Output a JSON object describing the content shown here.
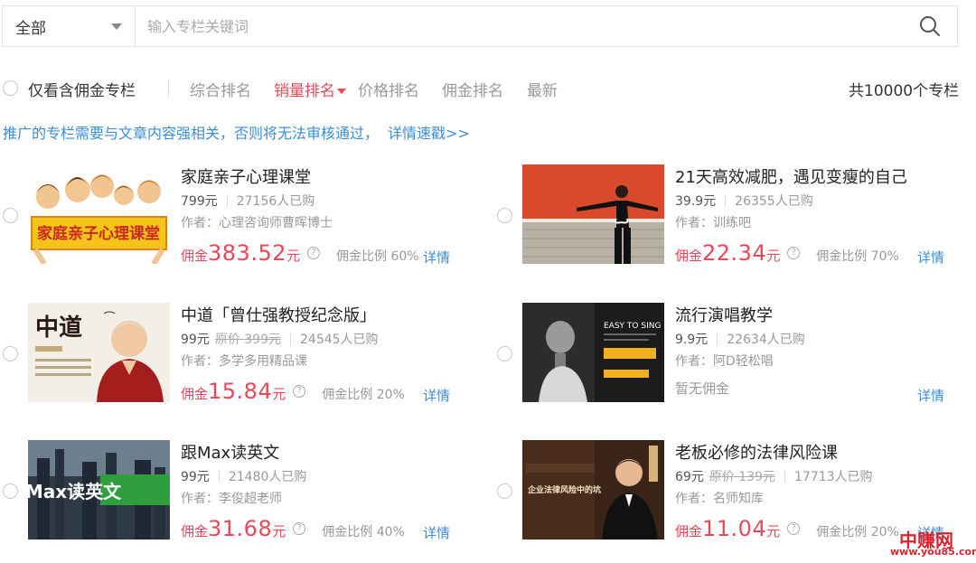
{
  "search": {
    "scope_label": "全部",
    "placeholder": "输入专栏关键词"
  },
  "filter": {
    "only_commission_label": "仅看含佣金专栏",
    "sort_options": [
      "综合排名",
      "销量排名",
      "价格排名",
      "佣金排名",
      "最新"
    ],
    "active_sort": "销量排名",
    "total_label": "共10000个专栏"
  },
  "notice": {
    "text": "推广的专栏需要与文章内容强相关，否则将无法审核通过，",
    "link": "详情速戳>>"
  },
  "cards": [
    {
      "title": "家庭亲子心理课堂",
      "price": "799元",
      "orig_price": "",
      "buyers": "27156人已购",
      "author": "作者：心理咨询师曹晖博士",
      "commission_label": "佣金",
      "commission_amount": "383.52",
      "commission_unit": "元",
      "ratio": "佣金比例 60%",
      "no_commission": "",
      "detail": "详情",
      "thumb_text": "家庭亲子心理课堂"
    },
    {
      "title": "21天高效减肥，遇见变瘦的自己",
      "price": "39.9元",
      "orig_price": "",
      "buyers": "26355人已购",
      "author": "作者：训练吧",
      "commission_label": "佣金",
      "commission_amount": "22.34",
      "commission_unit": "元",
      "ratio": "佣金比例 70%",
      "no_commission": "",
      "detail": "详情",
      "thumb_text": ""
    },
    {
      "title": "中道「曾仕强教授纪念版」",
      "price": "99元",
      "orig_price": "原价 399元",
      "buyers": "24545人已购",
      "author": "作者：多学多用精品课",
      "commission_label": "佣金",
      "commission_amount": "15.84",
      "commission_unit": "元",
      "ratio": "佣金比例 20%",
      "no_commission": "",
      "detail": "详情",
      "thumb_text": "中道"
    },
    {
      "title": "流行演唱教学",
      "price": "9.9元",
      "orig_price": "",
      "buyers": "22634人已购",
      "author": "作者：阿D轻松唱",
      "commission_label": "",
      "commission_amount": "",
      "commission_unit": "",
      "ratio": "",
      "no_commission": "暂无佣金",
      "detail": "详情",
      "thumb_text": "EASY TO SING"
    },
    {
      "title": "跟Max读英文",
      "price": "99元",
      "orig_price": "",
      "buyers": "21480人已购",
      "author": "作者：李俊超老师",
      "commission_label": "佣金",
      "commission_amount": "31.68",
      "commission_unit": "元",
      "ratio": "佣金比例 40%",
      "no_commission": "",
      "detail": "详情",
      "thumb_text": "跟Max读英文"
    },
    {
      "title": "老板必修的法律风险课",
      "price": "69元",
      "orig_price": "原价 139元",
      "buyers": "17713人已购",
      "author": "作者：名师知库",
      "commission_label": "佣金",
      "commission_amount": "11.04",
      "commission_unit": "元",
      "ratio": "佣金比例 20%",
      "no_commission": "",
      "detail": "详情",
      "thumb_text": "企业法律风险中的坑"
    }
  ],
  "watermark": {
    "name": "中赚网",
    "url": "www.you85.com"
  }
}
